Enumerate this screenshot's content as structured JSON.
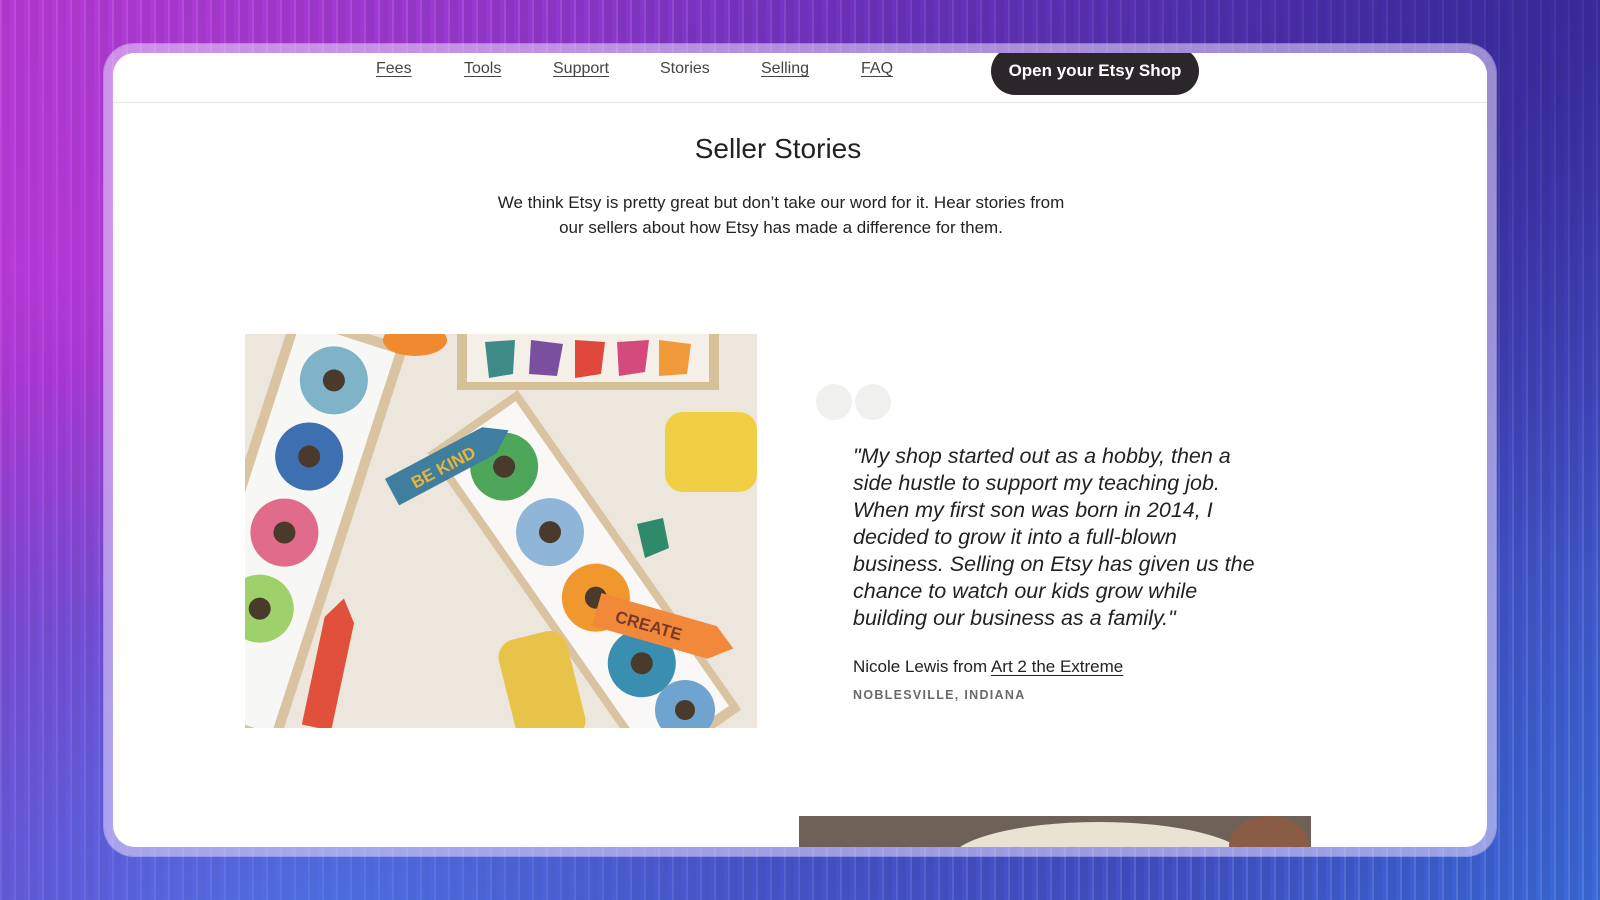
{
  "nav": {
    "items": [
      {
        "label": "Fees"
      },
      {
        "label": "Tools"
      },
      {
        "label": "Support"
      },
      {
        "label": "Stories"
      },
      {
        "label": "Selling"
      },
      {
        "label": "FAQ"
      }
    ],
    "cta_label": "Open your Etsy Shop"
  },
  "page": {
    "title": "Seller Stories",
    "subtitle": "We think Etsy is pretty great but don’t take our word for it. Hear stories from our sellers about how Etsy has made a difference for them."
  },
  "story": {
    "quote": "\"My shop started out as a hobby, then a side hustle to support my teaching job. When my first son was born in 2014, I decided to grow it into a full-blown business. Selling on Etsy has given us the chance to watch our kids grow while building our business as a family.\"",
    "author": "Nicole Lewis",
    "from_word": "from",
    "shop_link": "Art 2 the Extreme",
    "location": "NOBLESVILLE, INDIANA",
    "photo_text_1": "BE KIND",
    "photo_text_2": "CREATE"
  },
  "colors": {
    "cta_bg": "#2b2629",
    "text": "#222222",
    "muted": "#6a6a6a"
  }
}
